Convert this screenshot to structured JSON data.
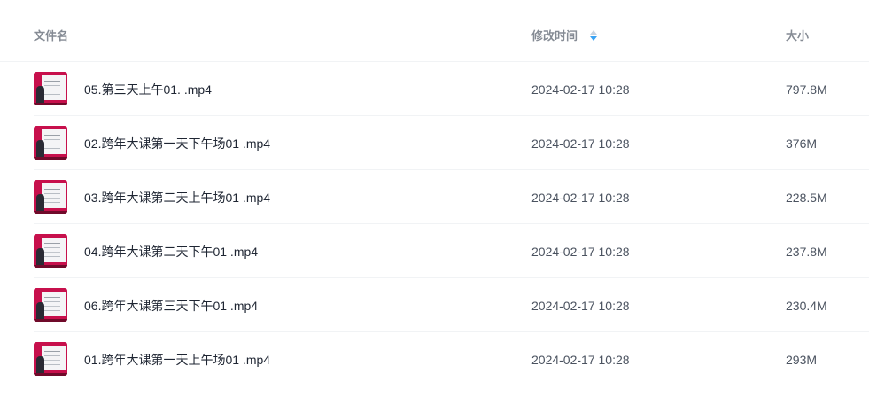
{
  "header": {
    "name": "文件名",
    "modified": "修改时间",
    "size": "大小"
  },
  "colors": {
    "thumb_brand": "#c7104c",
    "sort_active": "#3aa3f4",
    "sort_inactive": "#c9d3df"
  },
  "sort": {
    "column": "modified",
    "direction": "descending"
  },
  "files": [
    {
      "name": "05.第三天上午01. .mp4",
      "modified": "2024-02-17 10:28",
      "size": "797.8M",
      "icon": "video-thumbnail-icon"
    },
    {
      "name": "02.跨年大课第一天下午场01 .mp4",
      "modified": "2024-02-17 10:28",
      "size": "376M",
      "icon": "video-thumbnail-icon"
    },
    {
      "name": "03.跨年大课第二天上午场01 .mp4",
      "modified": "2024-02-17 10:28",
      "size": "228.5M",
      "icon": "video-thumbnail-icon"
    },
    {
      "name": "04.跨年大课第二天下午01 .mp4",
      "modified": "2024-02-17 10:28",
      "size": "237.8M",
      "icon": "video-thumbnail-icon"
    },
    {
      "name": "06.跨年大课第三天下午01 .mp4",
      "modified": "2024-02-17 10:28",
      "size": "230.4M",
      "icon": "video-thumbnail-icon"
    },
    {
      "name": "01.跨年大课第一天上午场01 .mp4",
      "modified": "2024-02-17 10:28",
      "size": "293M",
      "icon": "video-thumbnail-icon"
    }
  ]
}
